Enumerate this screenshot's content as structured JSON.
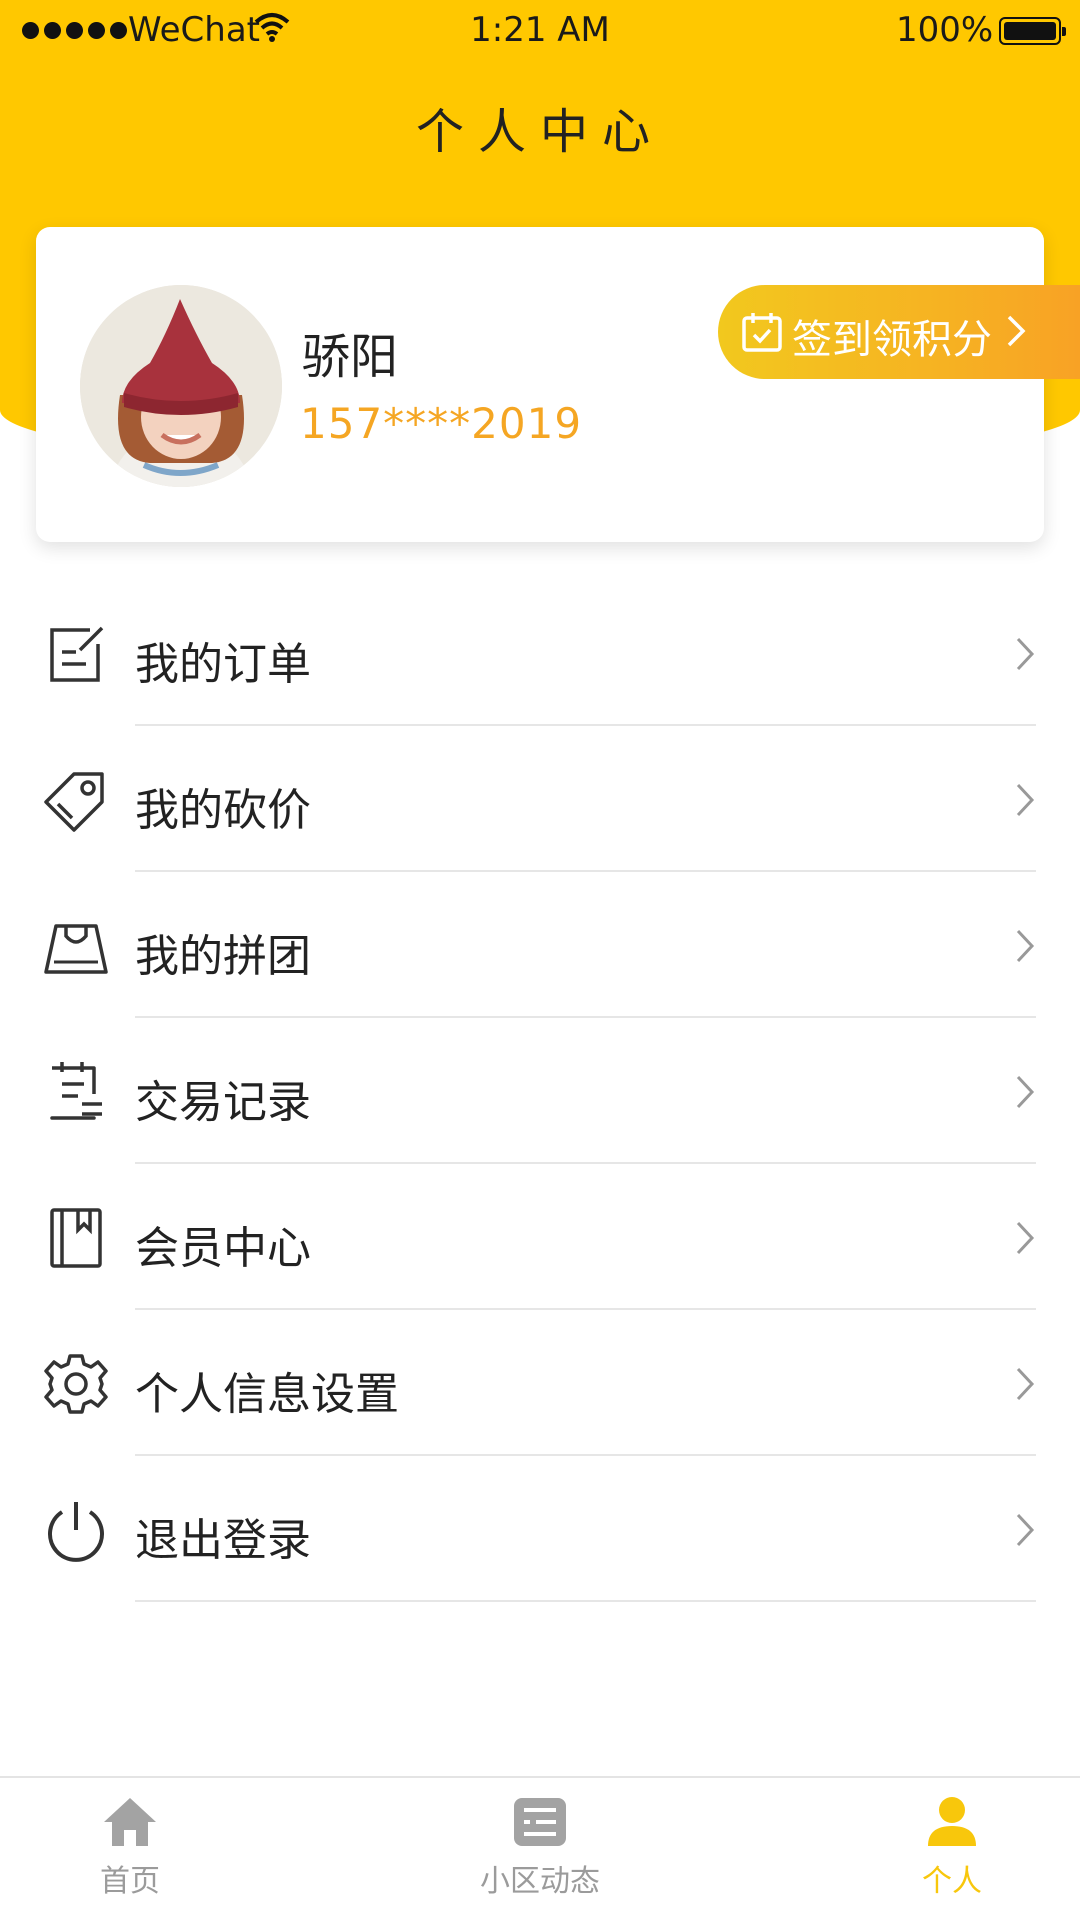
{
  "status_bar": {
    "carrier": "WeChat",
    "time": "1:21 AM",
    "battery": "100%"
  },
  "header": {
    "title": "个人中心"
  },
  "profile": {
    "name": "骄阳",
    "phone": "157****2019",
    "sign_in_label": "签到领积分"
  },
  "menu": [
    {
      "icon": "order-icon",
      "label": "我的订单"
    },
    {
      "icon": "price-tag-icon",
      "label": "我的砍价"
    },
    {
      "icon": "shopping-bag-icon",
      "label": "我的拼团"
    },
    {
      "icon": "receipt-icon",
      "label": "交易记录"
    },
    {
      "icon": "book-icon",
      "label": "会员中心"
    },
    {
      "icon": "gear-icon",
      "label": "个人信息设置"
    },
    {
      "icon": "power-icon",
      "label": "退出登录"
    }
  ],
  "tabbar": {
    "items": [
      {
        "icon": "home-icon",
        "label": "首页"
      },
      {
        "icon": "news-icon",
        "label": "小区动态"
      },
      {
        "icon": "person-icon",
        "label": "个人"
      }
    ],
    "active_index": 2
  },
  "colors": {
    "brand": "#FFC800",
    "accent": "#F5A623",
    "tab_active": "#F8C70C",
    "tab_inactive": "#9b9b9b"
  }
}
